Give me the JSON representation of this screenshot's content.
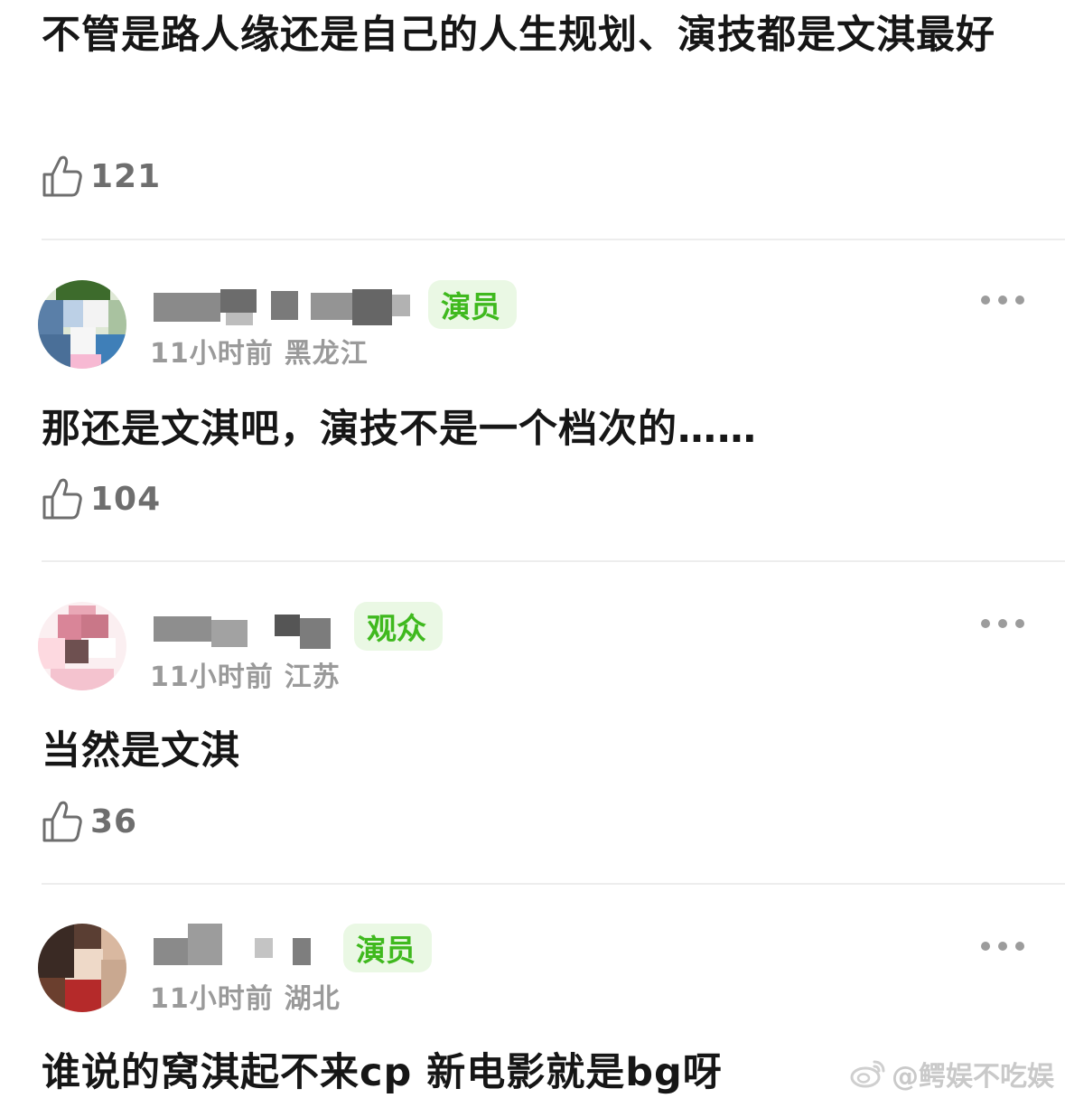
{
  "comments": [
    {
      "text": "不管是路人缘还是自己的人生规划、演技都是文淇最好",
      "likes": "121"
    },
    {
      "badge": "演员",
      "time": "11小时前",
      "location": "黑龙江",
      "text": "那还是文淇吧，演技不是一个档次的……",
      "likes": "104"
    },
    {
      "badge": "观众",
      "time": "11小时前",
      "location": "江苏",
      "text": "当然是文淇",
      "likes": "36"
    },
    {
      "badge": "演员",
      "time": "11小时前",
      "location": "湖北",
      "text": "谁说的窝淇起不来cp 新电影就是bg呀"
    }
  ],
  "icons": {
    "like": "thumbs-up-icon",
    "more": "more-dots-icon",
    "weibo": "weibo-logo-icon"
  },
  "colors": {
    "badge_text": "#3fb91e",
    "badge_bg": "#eaf8e4",
    "meta_text": "#9a9a9a",
    "divider": "#ededed"
  },
  "watermark": {
    "text": "@鳄娱不吃娱"
  }
}
